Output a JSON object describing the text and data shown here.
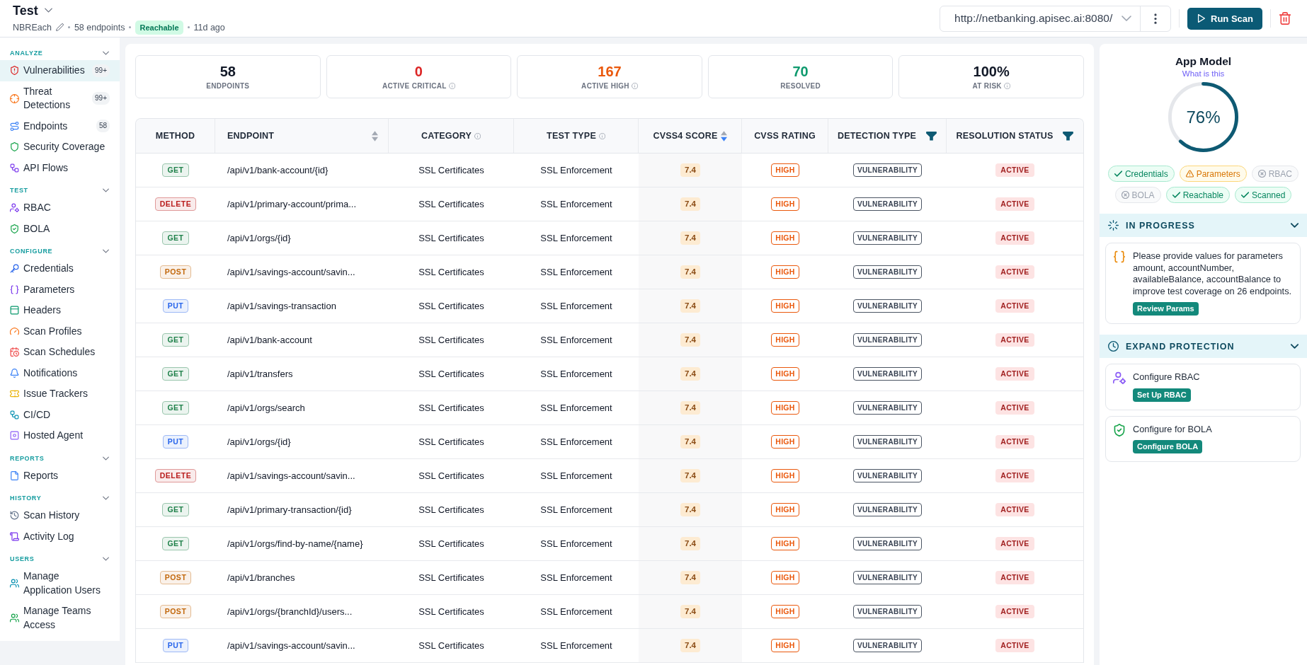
{
  "header": {
    "title": "Test",
    "subtitle": {
      "name": "NBREach",
      "endpoints": "58 endpoints",
      "status": "Reachable",
      "updated": "11d ago"
    },
    "url": "http://netbanking.apisec.ai:8080/",
    "run_button": "Run Scan"
  },
  "sidebar": {
    "sections": [
      {
        "title": "ANALYZE",
        "expanded": true,
        "items": [
          {
            "label": "Vulnerabilities",
            "badge": "99+",
            "selected": true
          },
          {
            "label": "Threat Detections",
            "badge": "99+",
            "selected": false
          },
          {
            "label": "Endpoints",
            "badge": "58",
            "selected": false
          },
          {
            "label": "Security Coverage",
            "selected": false
          },
          {
            "label": "API Flows",
            "selected": false
          }
        ]
      },
      {
        "title": "TEST",
        "expanded": true,
        "items": [
          {
            "label": "RBAC",
            "selected": false
          },
          {
            "label": "BOLA",
            "selected": false
          }
        ]
      },
      {
        "title": "CONFIGURE",
        "expanded": true,
        "items": [
          {
            "label": "Credentials",
            "selected": false
          },
          {
            "label": "Parameters",
            "selected": false
          },
          {
            "label": "Headers",
            "selected": false
          },
          {
            "label": "Scan Profiles",
            "selected": false
          },
          {
            "label": "Scan Schedules",
            "selected": false
          },
          {
            "label": "Notifications",
            "selected": false
          },
          {
            "label": "Issue Trackers",
            "selected": false
          },
          {
            "label": "CI/CD",
            "selected": false
          },
          {
            "label": "Hosted Agent",
            "selected": false
          }
        ]
      },
      {
        "title": "REPORTS",
        "expanded": true,
        "items": [
          {
            "label": "Reports",
            "selected": false
          }
        ]
      },
      {
        "title": "HISTORY",
        "expanded": true,
        "items": [
          {
            "label": "Scan History",
            "selected": false
          },
          {
            "label": "Activity Log",
            "selected": false
          }
        ]
      },
      {
        "title": "USERS",
        "expanded": true,
        "items": [
          {
            "label": "Manage Application Users",
            "selected": false
          },
          {
            "label": "Manage Teams Access",
            "selected": false
          }
        ]
      }
    ]
  },
  "stats": [
    {
      "value": "58",
      "label": "ENDPOINTS",
      "color": "#111827",
      "info": false
    },
    {
      "value": "0",
      "label": "ACTIVE CRITICAL",
      "color": "#dc2626",
      "info": true
    },
    {
      "value": "167",
      "label": "ACTIVE HIGH",
      "color": "#ea580c",
      "info": true
    },
    {
      "value": "70",
      "label": "RESOLVED",
      "color": "#0f9a6e",
      "info": false
    },
    {
      "value": "100%",
      "label": "AT RISK",
      "color": "#111827",
      "info": true
    }
  ],
  "table": {
    "columns": [
      {
        "label": "METHOD",
        "info": false,
        "filter": false,
        "sortable": false
      },
      {
        "label": "ENDPOINT",
        "info": false,
        "filter": false,
        "sortable": true,
        "sorted": false
      },
      {
        "label": "CATEGORY",
        "info": true,
        "filter": false,
        "sortable": false
      },
      {
        "label": "TEST TYPE",
        "info": true,
        "filter": false,
        "sortable": false
      },
      {
        "label": "CVSS4 SCORE",
        "info": false,
        "filter": false,
        "sortable": true,
        "sorted": true
      },
      {
        "label": "CVSS RATING",
        "info": false,
        "filter": false,
        "sortable": false
      },
      {
        "label": "DETECTION TYPE",
        "info": false,
        "filter": true,
        "sortable": false
      },
      {
        "label": "RESOLUTION STATUS",
        "info": false,
        "filter": true,
        "sortable": false
      }
    ],
    "rows": [
      {
        "method": {
          "label": "GET",
          "color": "#1e8049"
        },
        "endpoint": "/api/v1/bank-account/{id}",
        "category": "SSL Certificates",
        "test_type": "SSL Enforcement",
        "score": "7.4",
        "rating": "HIGH",
        "detection_type": "VULNERABILITY",
        "status": "ACTIVE"
      },
      {
        "method": {
          "label": "DELETE",
          "color": "#b91c1c"
        },
        "endpoint": "/api/v1/primary-account/prima...",
        "category": "SSL Certificates",
        "test_type": "SSL Enforcement",
        "score": "7.4",
        "rating": "HIGH",
        "detection_type": "VULNERABILITY",
        "status": "ACTIVE"
      },
      {
        "method": {
          "label": "GET",
          "color": "#1e8049"
        },
        "endpoint": "/api/v1/orgs/{id}",
        "category": "SSL Certificates",
        "test_type": "SSL Enforcement",
        "score": "7.4",
        "rating": "HIGH",
        "detection_type": "VULNERABILITY",
        "status": "ACTIVE"
      },
      {
        "method": {
          "label": "POST",
          "color": "#c2680c"
        },
        "endpoint": "/api/v1/savings-account/savin...",
        "category": "SSL Certificates",
        "test_type": "SSL Enforcement",
        "score": "7.4",
        "rating": "HIGH",
        "detection_type": "VULNERABILITY",
        "status": "ACTIVE"
      },
      {
        "method": {
          "label": "PUT",
          "color": "#2563eb"
        },
        "endpoint": "/api/v1/savings-transaction",
        "category": "SSL Certificates",
        "test_type": "SSL Enforcement",
        "score": "7.4",
        "rating": "HIGH",
        "detection_type": "VULNERABILITY",
        "status": "ACTIVE"
      },
      {
        "method": {
          "label": "GET",
          "color": "#1e8049"
        },
        "endpoint": "/api/v1/bank-account",
        "category": "SSL Certificates",
        "test_type": "SSL Enforcement",
        "score": "7.4",
        "rating": "HIGH",
        "detection_type": "VULNERABILITY",
        "status": "ACTIVE"
      },
      {
        "method": {
          "label": "GET",
          "color": "#1e8049"
        },
        "endpoint": "/api/v1/transfers",
        "category": "SSL Certificates",
        "test_type": "SSL Enforcement",
        "score": "7.4",
        "rating": "HIGH",
        "detection_type": "VULNERABILITY",
        "status": "ACTIVE"
      },
      {
        "method": {
          "label": "GET",
          "color": "#1e8049"
        },
        "endpoint": "/api/v1/orgs/search",
        "category": "SSL Certificates",
        "test_type": "SSL Enforcement",
        "score": "7.4",
        "rating": "HIGH",
        "detection_type": "VULNERABILITY",
        "status": "ACTIVE"
      },
      {
        "method": {
          "label": "PUT",
          "color": "#2563eb"
        },
        "endpoint": "/api/v1/orgs/{id}",
        "category": "SSL Certificates",
        "test_type": "SSL Enforcement",
        "score": "7.4",
        "rating": "HIGH",
        "detection_type": "VULNERABILITY",
        "status": "ACTIVE"
      },
      {
        "method": {
          "label": "DELETE",
          "color": "#b91c1c"
        },
        "endpoint": "/api/v1/savings-account/savin...",
        "category": "SSL Certificates",
        "test_type": "SSL Enforcement",
        "score": "7.4",
        "rating": "HIGH",
        "detection_type": "VULNERABILITY",
        "status": "ACTIVE"
      },
      {
        "method": {
          "label": "GET",
          "color": "#1e8049"
        },
        "endpoint": "/api/v1/primary-transaction/{id}",
        "category": "SSL Certificates",
        "test_type": "SSL Enforcement",
        "score": "7.4",
        "rating": "HIGH",
        "detection_type": "VULNERABILITY",
        "status": "ACTIVE"
      },
      {
        "method": {
          "label": "GET",
          "color": "#1e8049"
        },
        "endpoint": "/api/v1/orgs/find-by-name/{name}",
        "category": "SSL Certificates",
        "test_type": "SSL Enforcement",
        "score": "7.4",
        "rating": "HIGH",
        "detection_type": "VULNERABILITY",
        "status": "ACTIVE"
      },
      {
        "method": {
          "label": "POST",
          "color": "#c2680c"
        },
        "endpoint": "/api/v1/branches",
        "category": "SSL Certificates",
        "test_type": "SSL Enforcement",
        "score": "7.4",
        "rating": "HIGH",
        "detection_type": "VULNERABILITY",
        "status": "ACTIVE"
      },
      {
        "method": {
          "label": "POST",
          "color": "#c2680c"
        },
        "endpoint": "/api/v1/orgs/{branchId}/users...",
        "category": "SSL Certificates",
        "test_type": "SSL Enforcement",
        "score": "7.4",
        "rating": "HIGH",
        "detection_type": "VULNERABILITY",
        "status": "ACTIVE"
      },
      {
        "method": {
          "label": "PUT",
          "color": "#2563eb"
        },
        "endpoint": "/api/v1/savings-account/savin...",
        "category": "SSL Certificates",
        "test_type": "SSL Enforcement",
        "score": "7.4",
        "rating": "HIGH",
        "detection_type": "VULNERABILITY",
        "status": "ACTIVE"
      }
    ]
  },
  "panel": {
    "title": "App Model",
    "link": "What is this",
    "level": 0.62,
    "percent": "76%",
    "chips": [
      {
        "label": "Credentials",
        "kind": "done"
      },
      {
        "label": "Parameters",
        "kind": "warning"
      },
      {
        "label": "RBAC",
        "kind": "missing"
      },
      {
        "label": "BOLA",
        "kind": "missing"
      },
      {
        "label": "Reachable",
        "kind": "done"
      },
      {
        "label": "Scanned",
        "kind": "done"
      }
    ],
    "sections": [
      {
        "title": "IN PROGRESS",
        "expanded": true,
        "cards": [
          {
            "text": "Please provide values for parameters amount, accountNumber, availableBalance, accountBalance to improve test coverage on 26 endpoints.",
            "button": "Review Params"
          }
        ]
      },
      {
        "title": "EXPAND PROTECTION",
        "expanded": true,
        "cards": [
          {
            "text": "Configure RBAC",
            "button": "Set Up RBAC"
          },
          {
            "text": "Configure for BOLA",
            "button": "Configure BOLA"
          }
        ]
      }
    ]
  }
}
